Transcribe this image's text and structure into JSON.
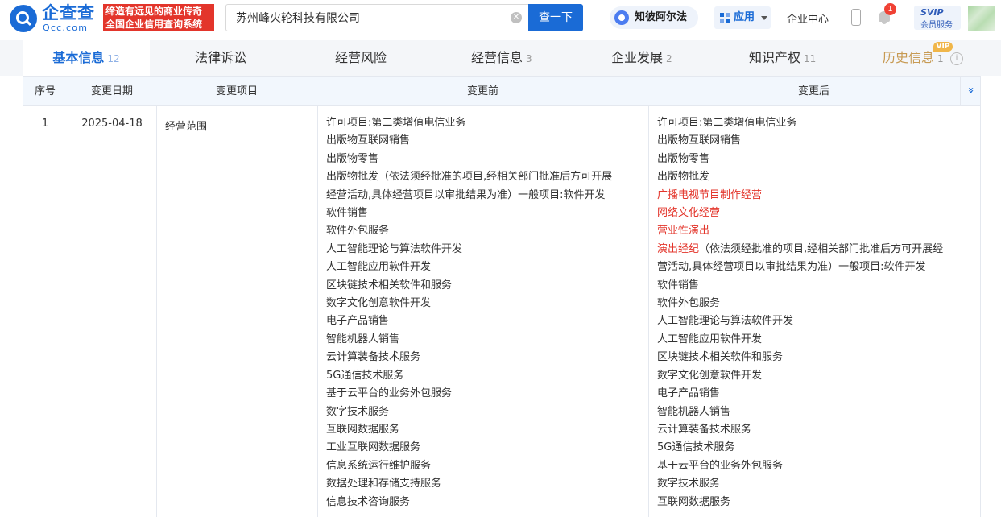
{
  "header": {
    "brand_cn": "企查查",
    "brand_en": "Qcc.com",
    "slogan_line1": "缔造有远见的商业传奇",
    "slogan_line2": "全国企业信用查询系统",
    "search_value": "苏州峰火轮科技有限公司",
    "search_button": "查一下",
    "zhibi_label": "知彼阿尔法",
    "apps_label": "应用",
    "enterprise_center": "企业中心",
    "notification_count": "1",
    "svip_top": "SVIP",
    "svip_bottom": "会员服务"
  },
  "tabs": [
    {
      "label": "基本信息",
      "count": "12"
    },
    {
      "label": "法律诉讼",
      "count": ""
    },
    {
      "label": "经营风险",
      "count": ""
    },
    {
      "label": "经营信息",
      "count": "3"
    },
    {
      "label": "企业发展",
      "count": "2"
    },
    {
      "label": "知识产权",
      "count": "11"
    },
    {
      "label": "历史信息",
      "count": "1"
    }
  ],
  "vip_tag": "VIP",
  "table": {
    "headers": [
      "序号",
      "变更日期",
      "变更项目",
      "变更前",
      "变更后"
    ],
    "row": {
      "index": "1",
      "date": "2025-04-18",
      "item": "经营范围",
      "before": [
        "许可项目:第二类增值电信业务",
        "出版物互联网销售",
        "出版物零售",
        "出版物批发（依法须经批准的项目,经相关部门批准后方可开展",
        "经营活动,具体经营项目以审批结果为准）一般项目:软件开发",
        "软件销售",
        "软件外包服务",
        "人工智能理论与算法软件开发",
        "人工智能应用软件开发",
        "区块链技术相关软件和服务",
        "数字文化创意软件开发",
        "电子产品销售",
        "智能机器人销售",
        "云计算装备技术服务",
        "5G通信技术服务",
        "基于云平台的业务外包服务",
        "数字技术服务",
        "互联网数据服务",
        "工业互联网数据服务",
        "信息系统运行维护服务",
        "数据处理和存储支持服务",
        "信息技术咨询服务"
      ],
      "after": [
        "许可项目:第二类增值电信业务",
        "出版物互联网销售",
        "出版物零售",
        "出版物批发",
        "广播电视节目制作经营",
        "网络文化经营",
        "营业性演出",
        "演出经纪",
        "（依法须经批准的项目,经相关部门批准后方可开展经",
        "营活动,具体经营项目以审批结果为准）一般项目:软件开发",
        "软件销售",
        "软件外包服务",
        "人工智能理论与算法软件开发",
        "人工智能应用软件开发",
        "区块链技术相关软件和服务",
        "数字文化创意软件开发",
        "电子产品销售",
        "智能机器人销售",
        "云计算装备技术服务",
        "5G通信技术服务",
        "基于云平台的业务外包服务",
        "数字技术服务",
        "互联网数据服务"
      ]
    }
  },
  "colors": {
    "brand_blue": "#1a6bd6",
    "highlight_red": "#e3352b",
    "history_gold": "#c79a53"
  }
}
